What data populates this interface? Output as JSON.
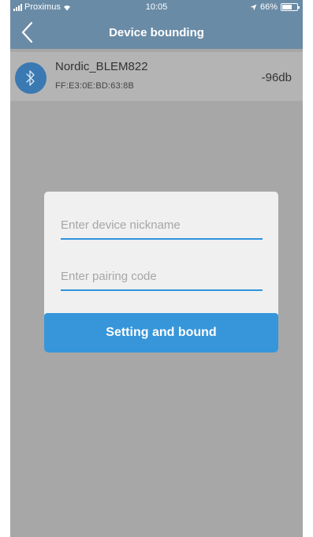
{
  "status_bar": {
    "carrier": "Proximus",
    "time": "10:05",
    "battery_text": "66%",
    "battery_level": 0.66
  },
  "nav": {
    "title": "Device bounding"
  },
  "device": {
    "name": "Nordic_BLEM822",
    "mac": "FF:E3:0E:BD:63:8B",
    "rssi": "-96db"
  },
  "dialog": {
    "nickname_placeholder": "Enter device nickname",
    "nickname_value": "",
    "pairing_placeholder": "Enter pairing code",
    "pairing_value": "",
    "button_label": "Setting and bound"
  },
  "colors": {
    "nav_background": "#6a8ba6",
    "accent": "#3796da",
    "overlay": "#a7a7a7"
  }
}
